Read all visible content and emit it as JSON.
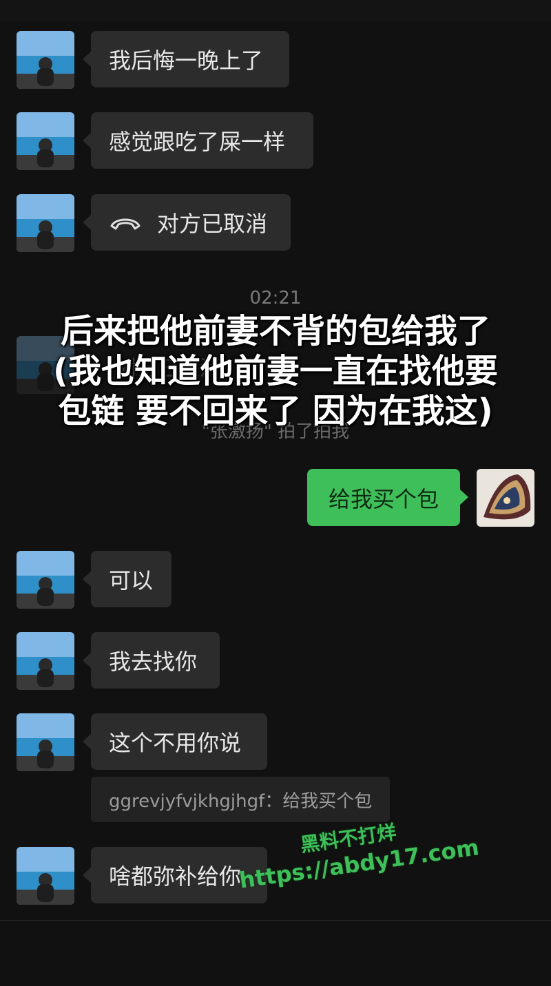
{
  "messages": [
    {
      "text": "我后悔一晚上了"
    },
    {
      "text": "感觉跟吃了屎一样"
    },
    {
      "text": "对方已取消",
      "icon": "phone-hangup-icon"
    },
    {
      "text": "给我买个包",
      "from": "me"
    },
    {
      "text": "可以"
    },
    {
      "text": "我去找你"
    },
    {
      "text": "这个不用你说"
    },
    {
      "text": "啥都弥补给你"
    }
  ],
  "timestamp": "02:21",
  "ghost": {
    "text": "对方已取消",
    "nudge": "\"张激扬\" 拍了拍我"
  },
  "overlay_caption": [
    "后来把他前妻不背的包给我了",
    "(我也知道他前妻一直在找他要",
    "包链 要不回来了 因为在我这)"
  ],
  "quote": "ggrevjyfvjkhgjhgf：给我买个包",
  "watermark": {
    "line1": "黑料不打烊",
    "line2": "https://abdy17.com"
  },
  "colors": {
    "background": "#111111",
    "bubble_other": "#2c2c2c",
    "bubble_me": "#3fbf5a",
    "watermark": "#3fbf5a"
  }
}
